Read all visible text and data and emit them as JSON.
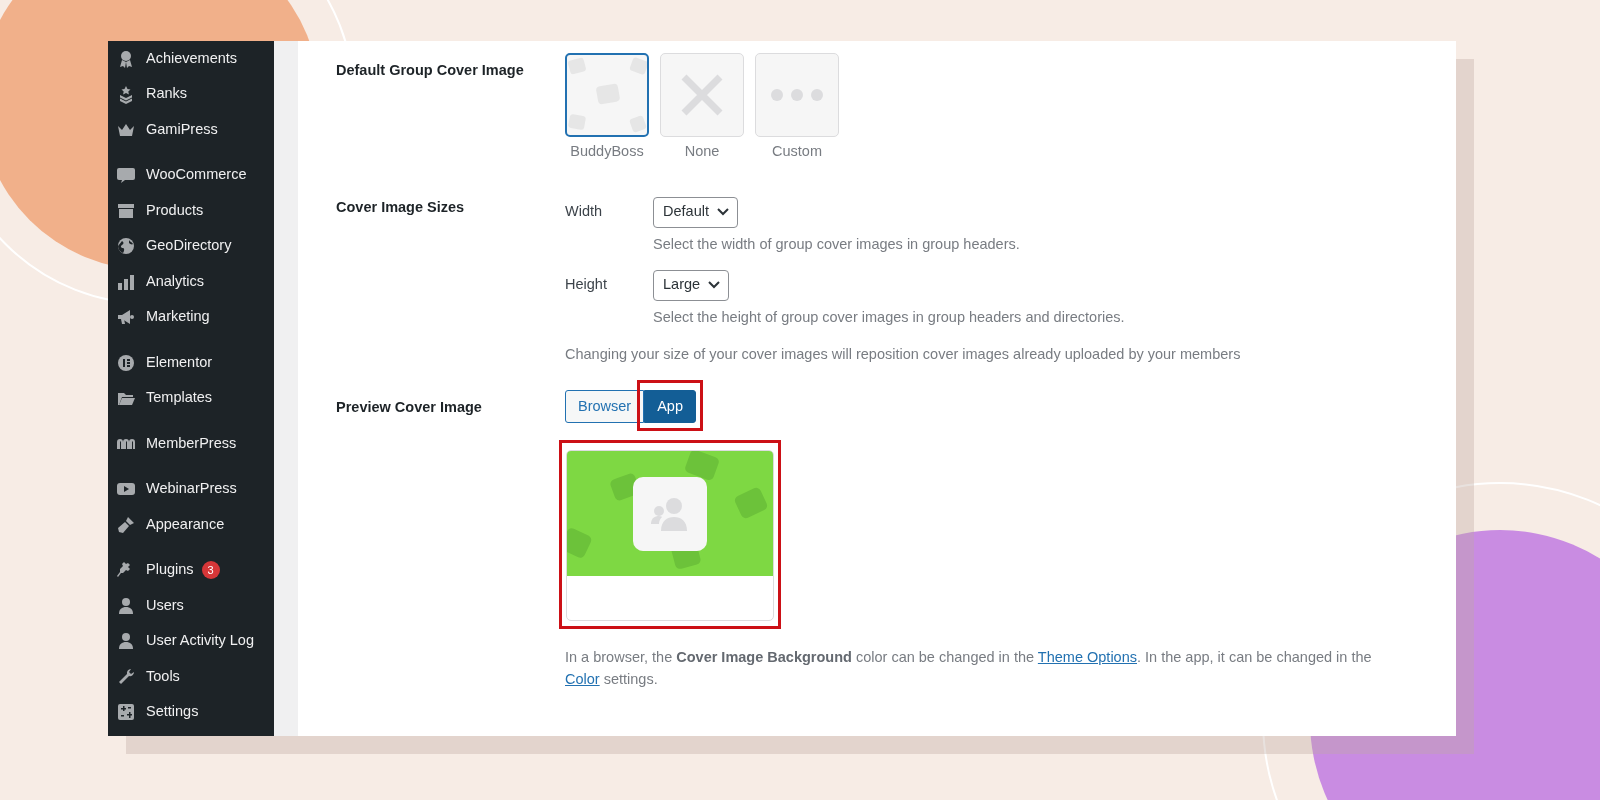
{
  "sidebar": {
    "groups": [
      [
        {
          "label": "Achievements"
        },
        {
          "label": "Ranks"
        },
        {
          "label": "GamiPress"
        }
      ],
      [
        {
          "label": "WooCommerce"
        },
        {
          "label": "Products"
        },
        {
          "label": "GeoDirectory"
        },
        {
          "label": "Analytics"
        },
        {
          "label": "Marketing"
        }
      ],
      [
        {
          "label": "Elementor"
        },
        {
          "label": "Templates"
        }
      ],
      [
        {
          "label": "MemberPress"
        }
      ],
      [
        {
          "label": "WebinarPress"
        },
        {
          "label": "Appearance"
        }
      ],
      [
        {
          "label": "Plugins",
          "badge": "3"
        },
        {
          "label": "Users"
        },
        {
          "label": "User Activity Log"
        },
        {
          "label": "Tools"
        },
        {
          "label": "Settings"
        }
      ]
    ]
  },
  "settings": {
    "rows": [
      {
        "kind": "cover_options",
        "label": "Default Group Cover Image",
        "options": [
          {
            "label": "BuddyBoss",
            "selected": true
          },
          {
            "label": "None",
            "selected": false
          },
          {
            "label": "Custom",
            "selected": false
          }
        ]
      },
      {
        "kind": "sizes",
        "label": "Cover Image Sizes",
        "fields": [
          {
            "label": "Width",
            "value": "Default",
            "description": "Select the width of group cover images in group headers."
          },
          {
            "label": "Height",
            "value": "Large",
            "description": "Select the height of group cover images in group headers and directories."
          }
        ],
        "note": "Changing your size of your cover images will reposition cover images already uploaded by your members"
      },
      {
        "kind": "preview",
        "label": "Preview Cover Image",
        "toggle": [
          {
            "label": "Browser",
            "selected": false,
            "highlighted": false
          },
          {
            "label": "App",
            "selected": true,
            "highlighted": true
          }
        ],
        "preview": {
          "highlighted": true
        },
        "description": [
          {
            "kind": "text",
            "text": "In a browser, the **Cover Image Background** color can be changed in the "
          },
          {
            "kind": "link",
            "text": "Theme Options"
          },
          {
            "kind": "text",
            "text": ". In the app, it can be changed in the "
          },
          {
            "kind": "link",
            "text": "Color"
          },
          {
            "kind": "text",
            "text": " settings."
          }
        ]
      }
    ]
  }
}
